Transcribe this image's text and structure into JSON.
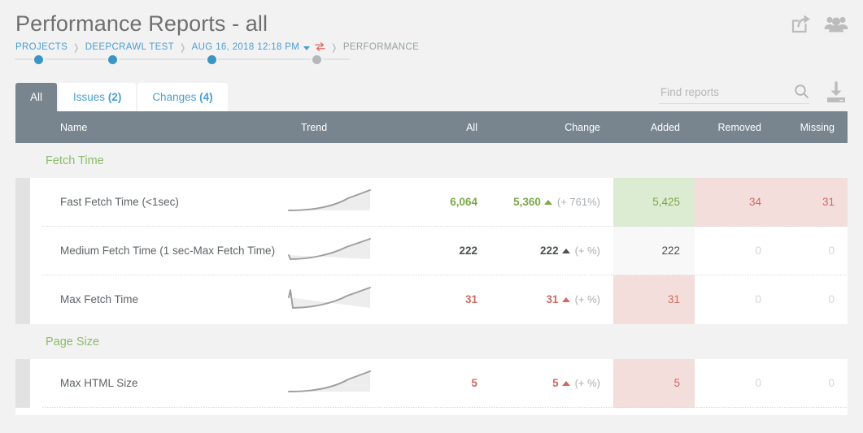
{
  "header": {
    "title": "Performance Reports - all",
    "breadcrumb": [
      {
        "label": "PROJECTS",
        "type": "link"
      },
      {
        "label": "DEEPCRAWL TEST",
        "type": "link"
      },
      {
        "label": "AUG 16, 2018 12:18 PM",
        "type": "link"
      },
      {
        "label": "PERFORMANCE",
        "type": "current"
      }
    ],
    "progress_dots": [
      "active",
      "active",
      "active",
      "inactive"
    ],
    "icons": [
      {
        "name": "share-icon"
      },
      {
        "name": "team-icon"
      }
    ],
    "caret_icon": "chevron-down-icon",
    "swap_icon": "compare-swap-icon"
  },
  "tabs": [
    {
      "label": "All",
      "count": "",
      "active": true
    },
    {
      "label": "Issues",
      "count": "(2)",
      "active": false
    },
    {
      "label": "Changes",
      "count": "(4)",
      "active": false
    }
  ],
  "search": {
    "placeholder": "Find reports",
    "value": "",
    "icon": "search-icon"
  },
  "download": {
    "icon": "download-icon",
    "label": "Download"
  },
  "table": {
    "columns": [
      "Name",
      "Trend",
      "All",
      "Change",
      "Added",
      "Removed",
      "Missing"
    ],
    "sections": [
      {
        "title": "Fetch Time",
        "rows": [
          {
            "name": "Fast Fetch Time (<1sec)",
            "trend": "rising",
            "all": "6,064",
            "change": "5,360",
            "change_dir": "up",
            "change_pct": "(+ 761%)",
            "added": "5,425",
            "removed": "34",
            "missing": "31",
            "all_color": "green",
            "change_color": "green",
            "added_color": "green",
            "removed_color": "red",
            "missing_color": "red",
            "added_bg": "green",
            "removed_bg": "red",
            "missing_bg": "red"
          },
          {
            "name": "Medium Fetch Time (1 sec-Max Fetch Time)",
            "trend": "dip-rising",
            "all": "222",
            "change": "222",
            "change_dir": "up",
            "change_pct": "(+ %)",
            "added": "222",
            "removed": "0",
            "missing": "0",
            "all_color": "dark",
            "change_color": "dark",
            "added_color": "dark",
            "removed_color": "zero",
            "missing_color": "zero",
            "added_bg": "grey",
            "removed_bg": "none",
            "missing_bg": "none"
          },
          {
            "name": "Max Fetch Time",
            "trend": "spike-rising",
            "all": "31",
            "change": "31",
            "change_dir": "up",
            "change_pct": "(+ %)",
            "added": "31",
            "removed": "0",
            "missing": "0",
            "all_color": "red",
            "change_color": "red",
            "added_color": "red",
            "removed_color": "zero",
            "missing_color": "zero",
            "added_bg": "red",
            "removed_bg": "none",
            "missing_bg": "none"
          }
        ]
      },
      {
        "title": "Page Size",
        "rows": [
          {
            "name": "Max HTML Size",
            "trend": "rising",
            "all": "5",
            "change": "5",
            "change_dir": "up",
            "change_pct": "(+ %)",
            "added": "5",
            "removed": "0",
            "missing": "0",
            "all_color": "red",
            "change_color": "red",
            "added_color": "red",
            "removed_color": "zero",
            "missing_color": "zero",
            "added_bg": "red",
            "removed_bg": "none",
            "missing_bg": "none"
          }
        ]
      }
    ]
  },
  "colors": {
    "accent_blue": "#4a9fd4",
    "header_slate": "#78858f",
    "green": "#7ba949",
    "section_green": "#8cbb6a",
    "red": "#cf6a62",
    "bg": "#f2f2f2"
  }
}
